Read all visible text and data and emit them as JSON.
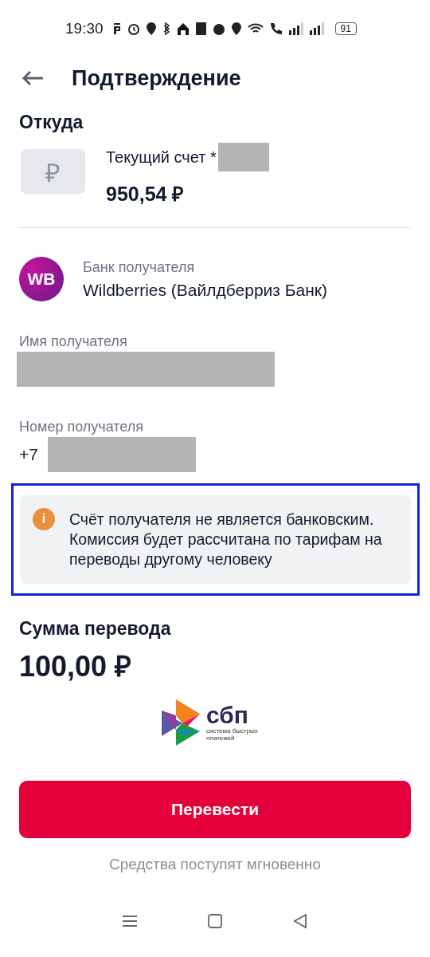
{
  "status_bar": {
    "time": "19:30",
    "battery": "91"
  },
  "header": {
    "title": "Подтверждение"
  },
  "source": {
    "heading": "Откуда",
    "currency_icon": "₽",
    "account_name": "Текущий счет *",
    "balance": "950,54 ₽"
  },
  "recipient_bank": {
    "avatar": "WB",
    "label": "Банк получателя",
    "value": "Wildberries (Вайлдберриз Банк)"
  },
  "recipient_name": {
    "label": "Имя получателя"
  },
  "recipient_phone": {
    "label": "Номер получателя",
    "prefix": "+7"
  },
  "notice": {
    "icon": "i",
    "text": "Счёт получателя не является банковским. Комиссия будет рассчитана по тарифам на переводы другому человеку",
    "highlighted": true
  },
  "amount": {
    "heading": "Сумма перевода",
    "value": "100,00 ₽"
  },
  "sbp": {
    "name": "сбп",
    "tagline": "система быстрых платежей"
  },
  "submit": {
    "label": "Перевести"
  },
  "footnote": "Средства поступят мгновенно"
}
